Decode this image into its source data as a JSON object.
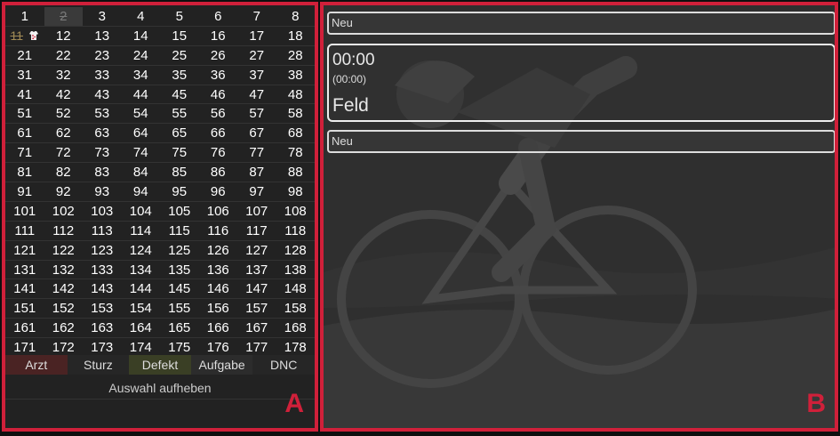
{
  "left_panel": {
    "label": "A",
    "grid_rows": [
      [
        "1",
        "2",
        "3",
        "4",
        "5",
        "6",
        "7",
        "8"
      ],
      [
        "11",
        "",
        "12",
        "13",
        "14",
        "15",
        "16",
        "17",
        "18"
      ],
      [
        "21",
        "22",
        "23",
        "24",
        "25",
        "26",
        "27",
        "28"
      ],
      [
        "31",
        "32",
        "33",
        "34",
        "35",
        "36",
        "37",
        "38"
      ],
      [
        "41",
        "42",
        "43",
        "44",
        "45",
        "46",
        "47",
        "48"
      ],
      [
        "51",
        "52",
        "53",
        "54",
        "55",
        "56",
        "57",
        "58"
      ],
      [
        "61",
        "62",
        "63",
        "64",
        "65",
        "66",
        "67",
        "68"
      ],
      [
        "71",
        "72",
        "73",
        "74",
        "75",
        "76",
        "77",
        "78"
      ],
      [
        "81",
        "82",
        "83",
        "84",
        "85",
        "86",
        "87",
        "88"
      ],
      [
        "91",
        "92",
        "93",
        "94",
        "95",
        "96",
        "97",
        "98"
      ],
      [
        "101",
        "102",
        "103",
        "104",
        "105",
        "106",
        "107",
        "108"
      ],
      [
        "111",
        "112",
        "113",
        "114",
        "115",
        "116",
        "117",
        "118"
      ],
      [
        "121",
        "122",
        "123",
        "124",
        "125",
        "126",
        "127",
        "128"
      ],
      [
        "131",
        "132",
        "133",
        "134",
        "135",
        "136",
        "137",
        "138"
      ],
      [
        "141",
        "142",
        "143",
        "144",
        "145",
        "146",
        "147",
        "148"
      ],
      [
        "151",
        "152",
        "153",
        "154",
        "155",
        "156",
        "157",
        "158"
      ],
      [
        "161",
        "162",
        "163",
        "164",
        "165",
        "166",
        "167",
        "168"
      ],
      [
        "171",
        "172",
        "173",
        "174",
        "175",
        "176",
        "177",
        "178"
      ]
    ],
    "struck_numbers": [
      "2",
      "11"
    ],
    "status_buttons": [
      "Arzt",
      "Sturz",
      "Defekt",
      "Aufgabe",
      "DNC"
    ],
    "clear_selection": "Auswahl aufheben",
    "colors": {
      "arzt": "#4a2323",
      "defekt": "#3a3f25",
      "accent": "#d0203a"
    }
  },
  "right_panel": {
    "label": "B",
    "top_field": "Neu",
    "timer": {
      "main": "00:00",
      "sub": "(00:00)",
      "label": "Feld"
    },
    "bottom_field": "Neu"
  }
}
